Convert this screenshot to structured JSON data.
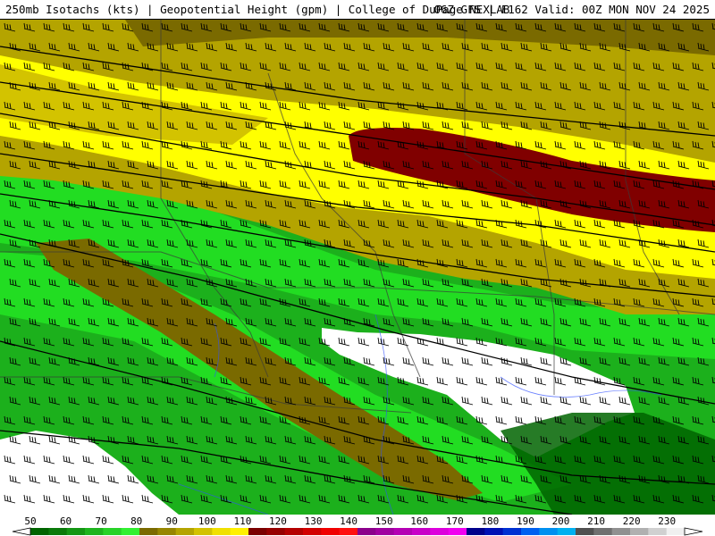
{
  "header": {
    "left": "250mb Isotachs (kts) | Geopotential Height (gpm) | College of DuPage NEXLAB",
    "right": "06Z GFS | F162 Valid: 00Z MON NOV 24 2025"
  },
  "colorbar": {
    "labels": [
      "50",
      "60",
      "70",
      "80",
      "90",
      "100",
      "110",
      "120",
      "130",
      "140",
      "150",
      "160",
      "170",
      "180",
      "190",
      "200",
      "210",
      "220",
      "230"
    ],
    "colors": [
      "#006400",
      "#0a7a0a",
      "#149614",
      "#1eb41e",
      "#28d228",
      "#32f032",
      "#7a6a00",
      "#968600",
      "#b4a400",
      "#d2c200",
      "#f0e000",
      "#fff000",
      "#7a0000",
      "#960000",
      "#b40000",
      "#d20000",
      "#f00000",
      "#ff1010",
      "#8b008b",
      "#a000a0",
      "#b400b4",
      "#c800c8",
      "#dc00dc",
      "#f000f0",
      "#00008b",
      "#0010b4",
      "#0030d2",
      "#0060f0",
      "#0090f0",
      "#00b0f0",
      "#505050",
      "#707070",
      "#909090",
      "#b0b0b0",
      "#d0d0d0",
      "#f0f0f0"
    ]
  },
  "map": {
    "fill_colors": {
      "white": "#ffffff",
      "dark_green": "#006400",
      "mid_green": "#1cb01c",
      "bright_green": "#22dd22",
      "olive": "#7a6a00",
      "light_olive": "#b4a400",
      "yellow": "#ffff00",
      "dark_red": "#800000"
    },
    "barb_color": "#000000",
    "contour_color": "#000000",
    "border_color": "#3a3a3a",
    "river_color": "#3050ff"
  }
}
